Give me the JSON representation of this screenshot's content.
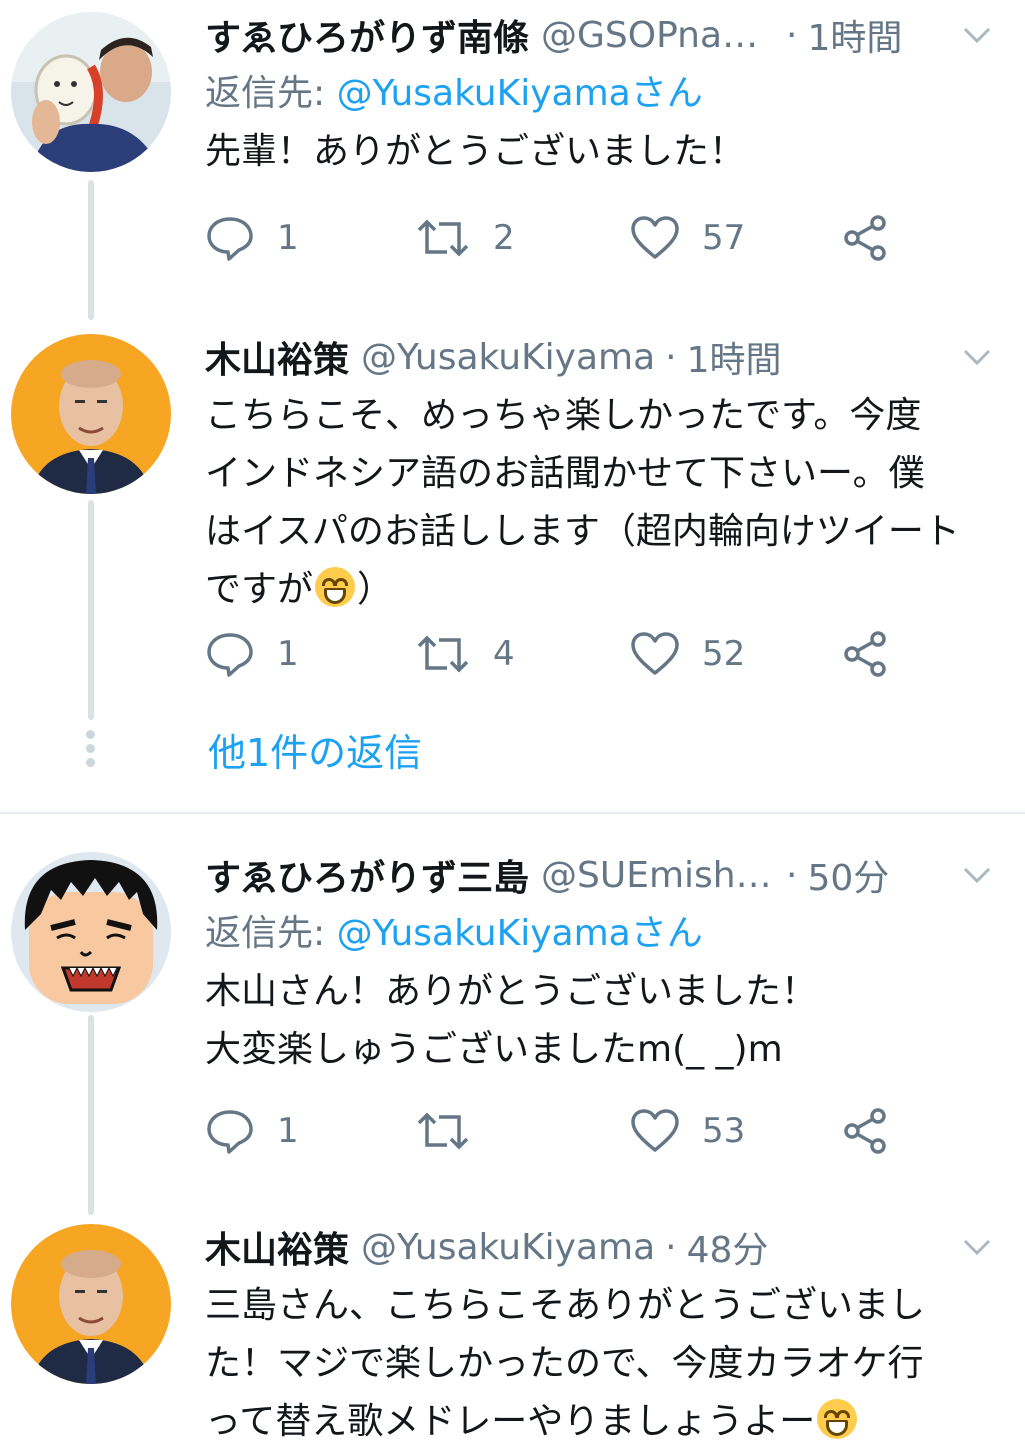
{
  "tweets": [
    {
      "name": "すゑひろがりず南條",
      "handle": "@GSOPnan…",
      "time": "1時間",
      "reply_prefix": "返信先: ",
      "reply_to": "@YusakuKiyamaさん",
      "lines": [
        "先輩！ありがとうございました！"
      ],
      "replies": "1",
      "retweets": "2",
      "likes": "57",
      "avatar_icon": "photo-avatar-icon"
    },
    {
      "name": "木山裕策",
      "handle": "@YusakuKiyama",
      "time": "1時間",
      "lines": [
        "こちらこそ、めっちゃ楽しかったです。今度",
        "インドネシア語のお話聞かせて下さいー。僕",
        "はイスパのお話しします（超内輪向けツイート",
        "ですが",
        "）"
      ],
      "replies": "1",
      "retweets": "4",
      "likes": "52",
      "avatar_icon": "person-avatar-icon"
    },
    {
      "name": "すゑひろがりず三島",
      "handle": "@SUEmishi…",
      "time": "50分",
      "reply_prefix": "返信先: ",
      "reply_to": "@YusakuKiyamaさん",
      "lines": [
        "木山さん！ありがとうございました！",
        "大変楽しゅうございましたm(_ _)m"
      ],
      "replies": "1",
      "retweets": "",
      "likes": "53",
      "avatar_icon": "cartoon-face-avatar-icon"
    },
    {
      "name": "木山裕策",
      "handle": "@YusakuKiyama",
      "time": "48分",
      "lines": [
        "三島さん、こちらこそありがとうございまし",
        "た！マジで楽しかったので、今度カラオケ行",
        "って替え歌メドレーやりましょうよー"
      ],
      "avatar_icon": "person-avatar-icon"
    }
  ],
  "more_replies": "他1件の返信",
  "separator": "·",
  "colors": {
    "accent": "#1da1f2",
    "muted": "#657786",
    "thread_line": "#dde1e5",
    "divider": "#e6ecf0"
  }
}
